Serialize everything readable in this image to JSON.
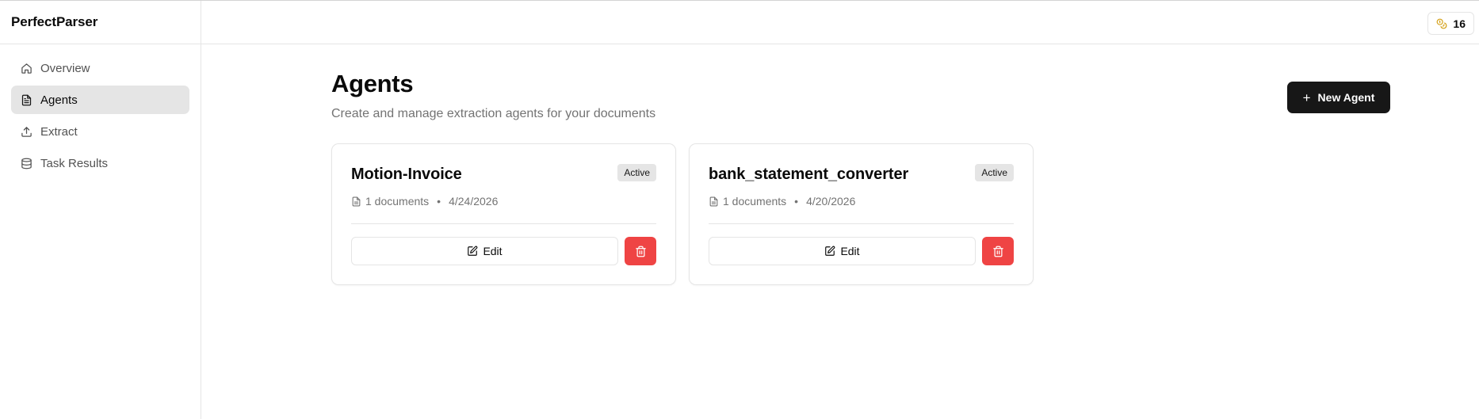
{
  "app": {
    "brand": "PerfectParser"
  },
  "sidebar": {
    "items": [
      {
        "label": "Overview",
        "icon": "home-icon",
        "active": false
      },
      {
        "label": "Agents",
        "icon": "file-icon",
        "active": true
      },
      {
        "label": "Extract",
        "icon": "upload-icon",
        "active": false
      },
      {
        "label": "Task Results",
        "icon": "database-icon",
        "active": false
      }
    ]
  },
  "topbar": {
    "credits": "16",
    "credits_icon": "coins-icon"
  },
  "page": {
    "title": "Agents",
    "subtitle": "Create and manage extraction agents for your documents",
    "new_button": "New Agent"
  },
  "agents": [
    {
      "name": "Motion-Invoice",
      "status": "Active",
      "documents": "1 documents",
      "date": "4/24/2026",
      "edit_label": "Edit"
    },
    {
      "name": "bank_statement_converter",
      "status": "Active",
      "documents": "1 documents",
      "date": "4/20/2026",
      "edit_label": "Edit"
    }
  ],
  "colors": {
    "accent": "#171717",
    "danger": "#ef4444",
    "credits_icon": "#d4a017"
  }
}
